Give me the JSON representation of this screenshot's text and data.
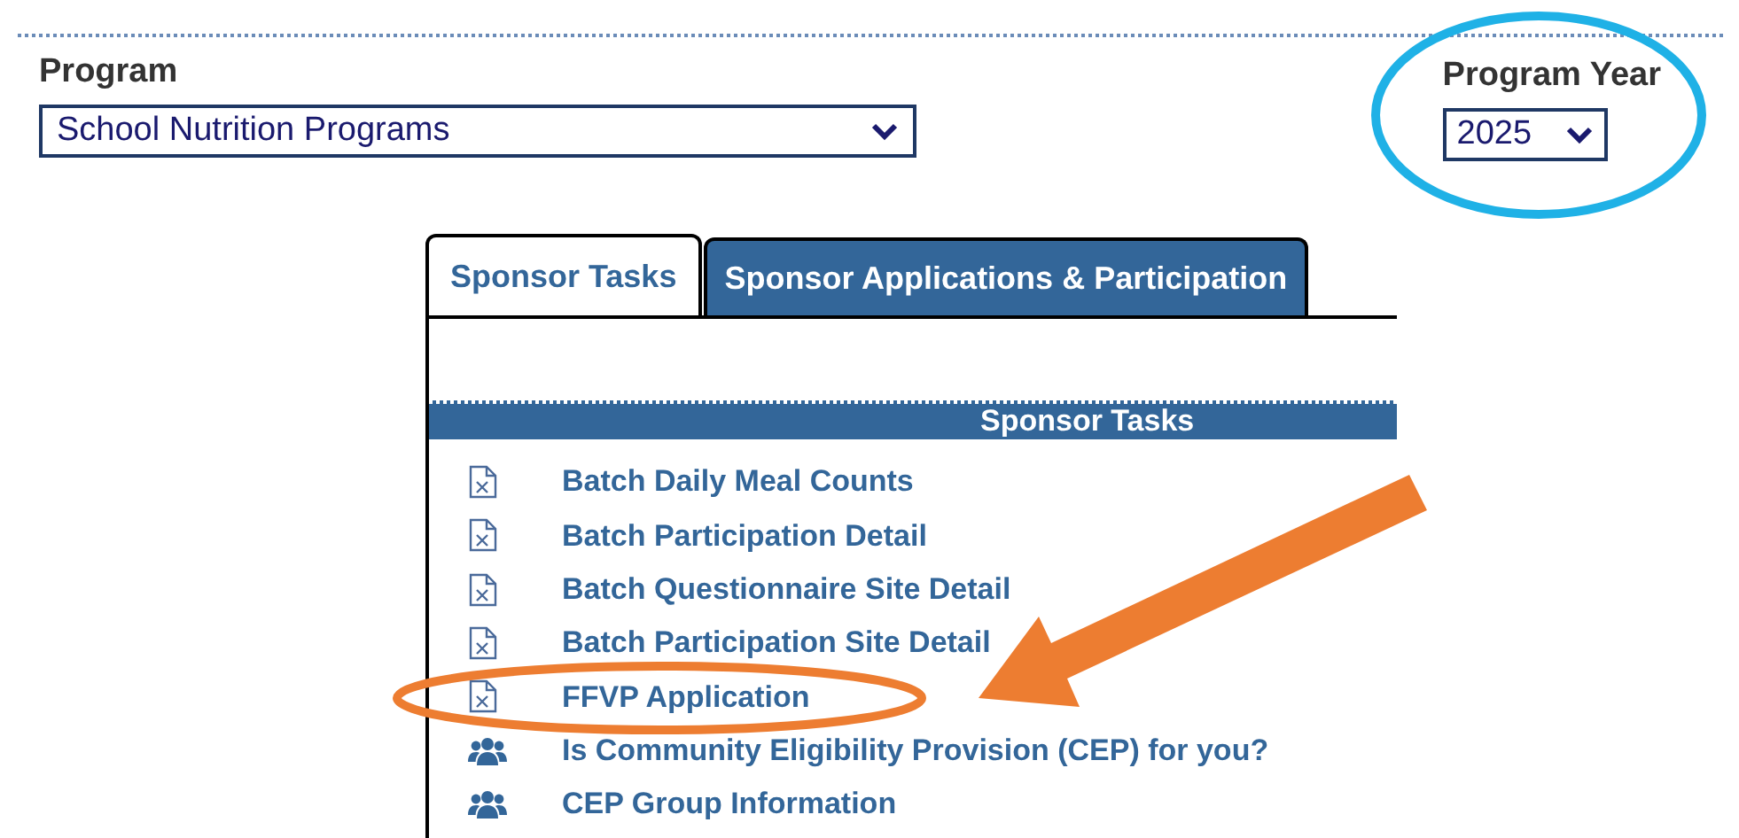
{
  "program": {
    "label": "Program",
    "value": "School Nutrition Programs"
  },
  "program_year": {
    "label": "Program Year",
    "value": "2025"
  },
  "tabs": [
    {
      "label": "Sponsor Tasks",
      "selected": true
    },
    {
      "label": "Sponsor Applications & Participation",
      "selected": false
    }
  ],
  "panel": {
    "title": "Sponsor Tasks",
    "items": [
      {
        "kind": "document",
        "label": "Batch Daily Meal Counts"
      },
      {
        "kind": "document",
        "label": "Batch Participation Detail"
      },
      {
        "kind": "document",
        "label": "Batch Questionnaire Site Detail"
      },
      {
        "kind": "document",
        "label": "Batch Participation Site Detail"
      },
      {
        "kind": "document",
        "label": "FFVP Application"
      },
      {
        "kind": "group",
        "label": "Is Community Eligibility Provision (CEP) for you?"
      },
      {
        "kind": "group",
        "label": "CEP Group Information"
      }
    ]
  }
}
